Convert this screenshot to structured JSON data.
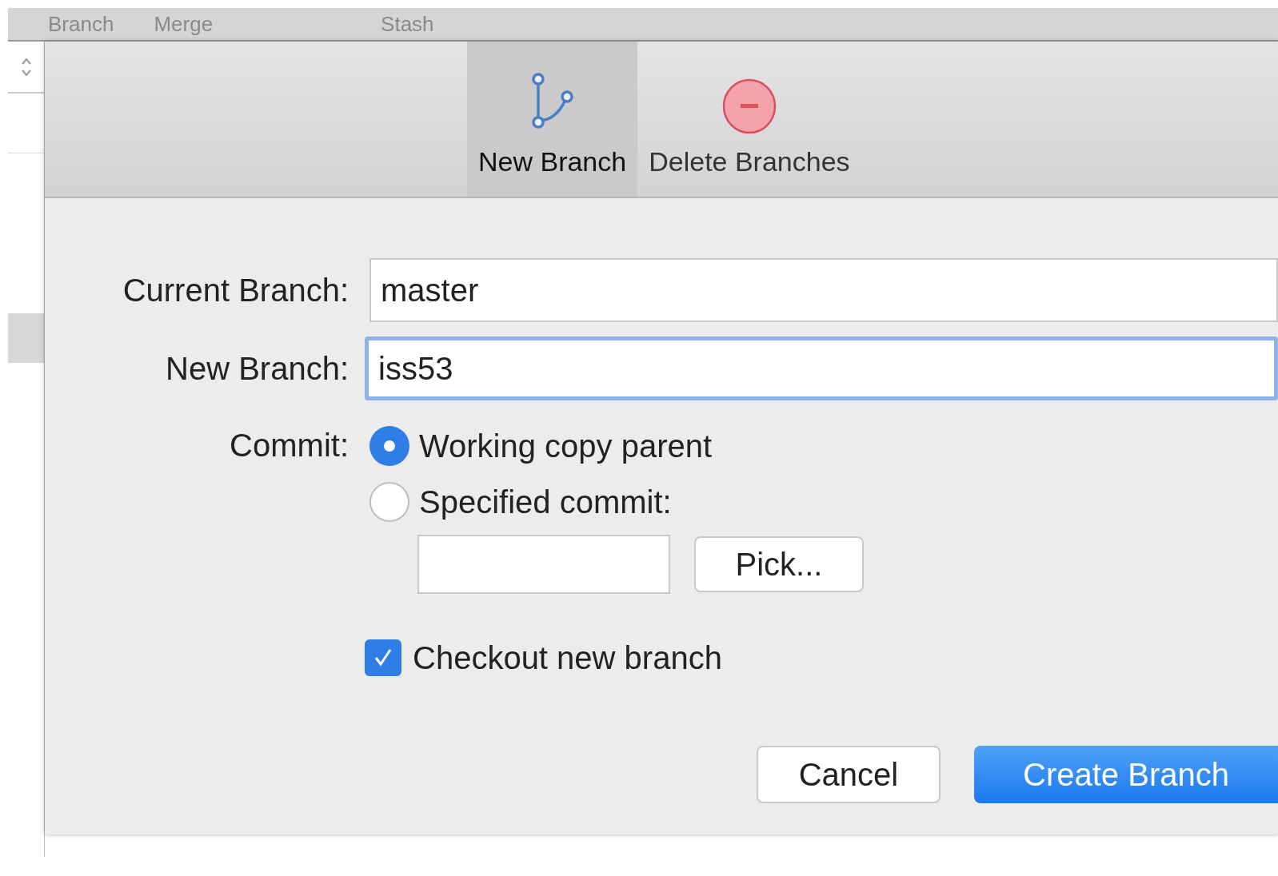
{
  "menu": [
    {
      "label": "Branch"
    },
    {
      "label": "Merge"
    },
    {
      "label": "Stash"
    }
  ],
  "toolbar": [
    {
      "label": "New Branch",
      "kind": "branch",
      "selected": true
    },
    {
      "label": "Delete Branches",
      "kind": "delete",
      "selected": false
    }
  ],
  "form": {
    "current_branch": {
      "label": "Current Branch:",
      "value": "master",
      "focused": false
    },
    "new_branch": {
      "label": "New Branch:",
      "value": "iss53",
      "focused": true
    },
    "commit": {
      "label": "Commit:",
      "options": [
        {
          "label": "Working copy parent",
          "selected": true
        },
        {
          "label": "Specified commit:",
          "selected": false
        }
      ],
      "pick_button": "Pick..."
    },
    "checkout": {
      "label": "Checkout new branch",
      "checked": true
    }
  },
  "buttons": [
    {
      "label": "Cancel",
      "kind": "secondary"
    },
    {
      "label": "Create Branch",
      "kind": "primary"
    }
  ]
}
